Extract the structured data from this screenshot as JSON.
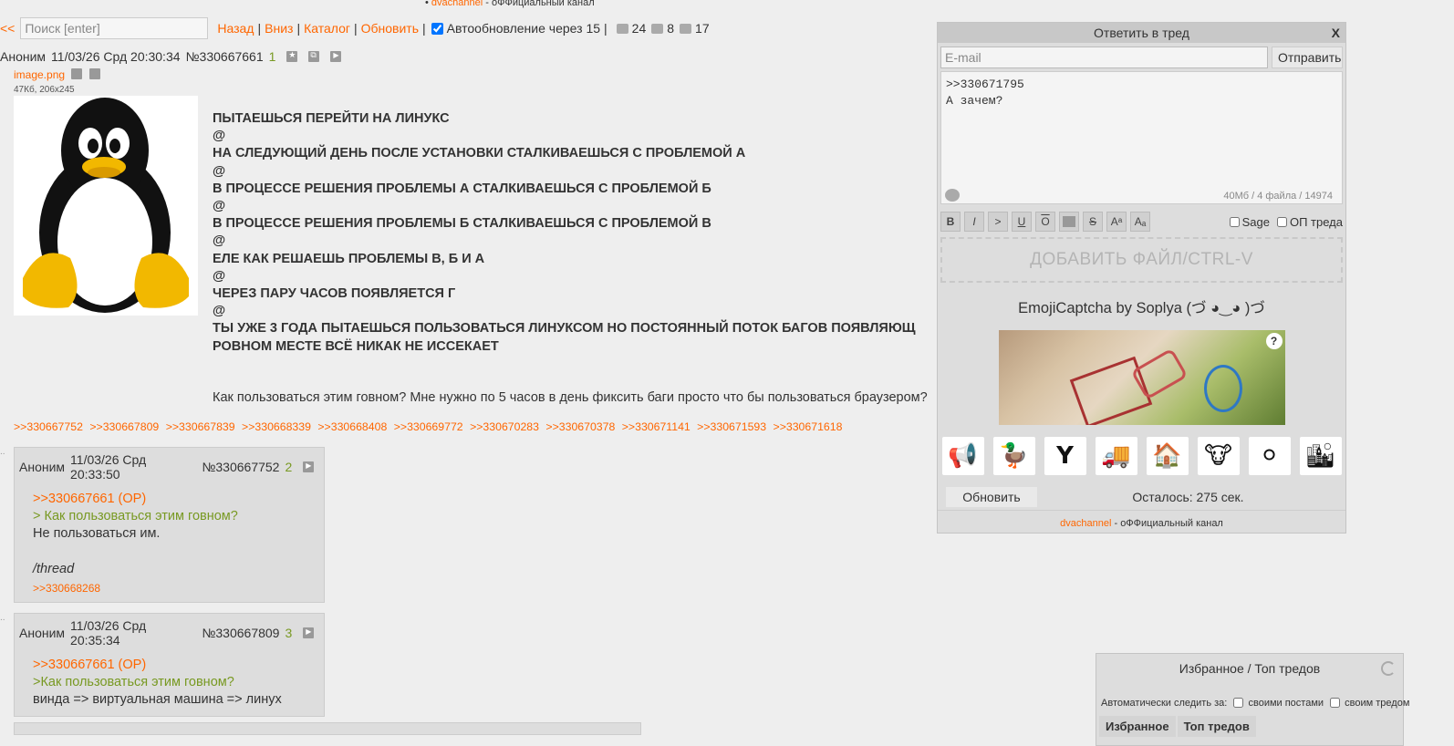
{
  "banner": {
    "bullet": "•",
    "channel_link": "dvachannel",
    "channel_text": "- оФФициальный канал"
  },
  "topbar": {
    "back_arrow": "<<",
    "search_placeholder": "Поиск [enter]",
    "nav_back": "Назад",
    "nav_down": "Вниз",
    "nav_catalog": "Каталог",
    "nav_refresh": "Обновить",
    "auto_refresh_label": "Автообновление через 15",
    "posts_count": "24",
    "images_count": "8",
    "users_count": "17",
    "sep": "|"
  },
  "op": {
    "author": "Аноним",
    "date": "11/03/26 Срд 20:30:34",
    "number": "№330667661",
    "ordinal": "1",
    "file_name": "image.png",
    "file_meta": "47Кб, 206x245",
    "lines": [
      "ПЫТАЕШЬСЯ ПЕРЕЙТИ НА ЛИНУКС",
      "@",
      "НА СЛЕДУЮЩИЙ ДЕНЬ ПОСЛЕ УСТАНОВКИ СТАЛКИВАЕШЬСЯ С ПРОБЛЕМОЙ А",
      "@",
      "В ПРОЦЕССЕ РЕШЕНИЯ ПРОБЛЕМЫ А СТАЛКИВАЕШЬСЯ С ПРОБЛЕМОЙ Б",
      "@",
      "В ПРОЦЕССЕ РЕШЕНИЯ ПРОБЛЕМЫ Б СТАЛКИВАЕШЬСЯ С ПРОБЛЕМОЙ В",
      "@",
      "ЕЛЕ КАК РЕШАЕШЬ ПРОБЛЕМЫ В, Б И А",
      "@",
      "ЧЕРЕЗ ПАРУ ЧАСОВ ПОЯВЛЯЕТСЯ Г",
      "@",
      "ТЫ УЖЕ 3 ГОДА ПЫТАЕШЬСЯ ПОЛЬЗОВАТЬСЯ ЛИНУКСОМ НО ПОСТОЯННЫЙ ПОТОК БАГОВ ПОЯВЛЯЮЩ",
      "РОВНОМ МЕСТЕ ВСЁ НИКАК НЕ ИССЕКАЕТ"
    ],
    "question": "Как пользоваться этим говном? Мне нужно по 5 часов в день фиксить баги просто что бы пользоваться браузером?",
    "replies": [
      ">>330667752",
      ">>330667809",
      ">>330667839",
      ">>330668339",
      ">>330668408",
      ">>330669772",
      ">>330670283",
      ">>330670378",
      ">>330671141",
      ">>330671593",
      ">>330671618"
    ]
  },
  "posts": [
    {
      "author": "Аноним",
      "date": "11/03/26 Срд 20:33:50",
      "number": "№330667752",
      "ordinal": "2",
      "reply_link": ">>330667661 (OP)",
      "quote": "> Как пользоваться этим говном?",
      "text": "Не пользоваться им.",
      "text2": "/thread",
      "refs": ">>330668268"
    },
    {
      "author": "Аноним",
      "date": "11/03/26 Срд 20:35:34",
      "number": "№330667809",
      "ordinal": "3",
      "reply_link": ">>330667661 (OP)",
      "quote": ">Как пользоваться этим говном?",
      "text": "винда => виртуальная машина => линух"
    }
  ],
  "reply_form": {
    "title": "Ответить в тред",
    "close": "X",
    "email_placeholder": "E-mail",
    "send": "Отправить",
    "message": ">>330671795\nА зачем?",
    "counter": "40Мб / 4 файла / 14974",
    "fmt": [
      "B",
      "I",
      ">",
      "U",
      "O",
      "",
      "S",
      "Aᵃ",
      "Aₐ"
    ],
    "sage_label": "Sage",
    "op_label": "ОП треда",
    "drop_zone": "ДОБАВИТЬ ФАЙЛ/CTRL-V",
    "captcha_title": "EmojiCaptcha by Soplya (づ ◕‿◕ )づ",
    "captcha_help": "?",
    "emoji": [
      {
        "icon": "megaphone-icon",
        "glyph": "📢"
      },
      {
        "icon": "duck-icon",
        "glyph": "🦆"
      },
      {
        "icon": "y-letter-icon",
        "glyph": "Y"
      },
      {
        "icon": "truck-icon",
        "glyph": "🚚"
      },
      {
        "icon": "house-icon",
        "glyph": "🏠"
      },
      {
        "icon": "cow-icon",
        "glyph": "🐮"
      },
      {
        "icon": "golf-ball-icon",
        "glyph": "⚪"
      },
      {
        "icon": "city-icon",
        "glyph": "🏙"
      }
    ],
    "refresh": "Обновить",
    "remaining": "Осталось: 275 сек.",
    "footer_link": "dvachannel",
    "footer_text": "- оФФициальный канал"
  },
  "favorites": {
    "title": "Избранное / Топ тредов",
    "auto_label": "Автоматически следить за:",
    "own_posts": "своими постами",
    "own_thread": "своим тредом",
    "tab_favorites": "Избранное",
    "tab_top": "Топ тредов"
  },
  "colors": {
    "link": "#ff6600",
    "quote": "#789922",
    "bg": "#eeeeee",
    "post_bg": "#dddddd"
  }
}
